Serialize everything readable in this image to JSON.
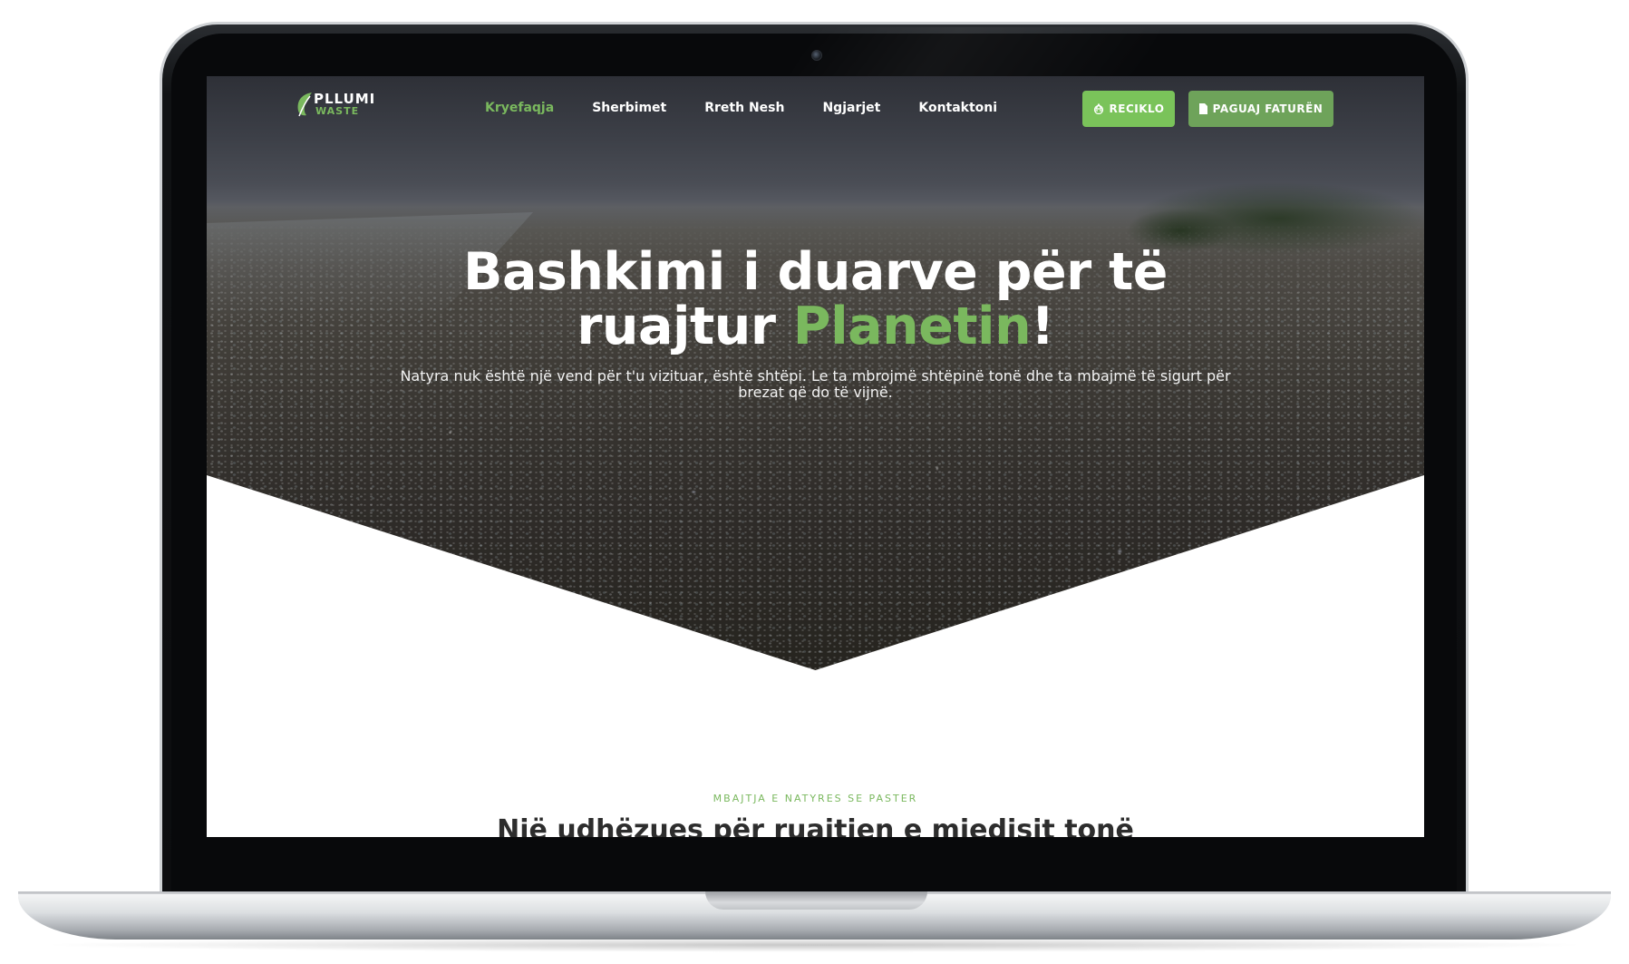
{
  "brand": {
    "name_line1": "PLLUMI",
    "name_line2": "WASTE",
    "accent_color": "#7ab85e"
  },
  "nav": {
    "items": [
      {
        "label": "Kryefaqja",
        "active": true
      },
      {
        "label": "Sherbimet",
        "active": false
      },
      {
        "label": "Rreth Nesh",
        "active": false
      },
      {
        "label": "Ngjarjet",
        "active": false
      },
      {
        "label": "Kontaktoni",
        "active": false
      }
    ],
    "recycle_button": {
      "label": "RECIKLO",
      "icon": "recycle-icon"
    },
    "pay_button": {
      "label": "PAGUAJ FATURËN",
      "icon": "document-icon"
    }
  },
  "hero": {
    "title_line1": "Bashkimi i duarve për të",
    "title_line2_start": "ruajtur ",
    "title_accent": "Planetin",
    "title_end": "!",
    "subtitle": "Natyra nuk është një vend për t'u vizituar, është shtëpi. Le ta mbrojmë shtëpinë tonë dhe ta mbajmë të sigurt për brezat që do të vijnë."
  },
  "section": {
    "eyebrow": "MBAJTJA E NATYRES SE PASTER",
    "title": "Një udhëzues për ruajtjen e mjedisit tonë"
  }
}
